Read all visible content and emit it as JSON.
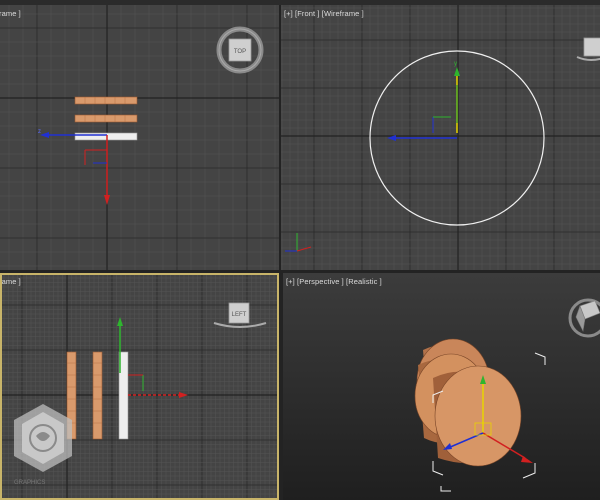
{
  "viewports": {
    "top": {
      "label": "rame ]",
      "viewcube": "TOP"
    },
    "front": {
      "label": "[+] [Front ] [Wireframe ]"
    },
    "left": {
      "label": "rame ]",
      "viewcube": "LEFT"
    },
    "perspective": {
      "label": "[+] [Perspective ] [Realistic ]"
    }
  },
  "watermark": {
    "text": "GRAPHICS"
  },
  "colors": {
    "viewport_bg": "#444444",
    "grid_minor": "#555555",
    "grid_major": "#2a2a2a",
    "active_border": "#c8b469",
    "object_orange": "#d99a6c",
    "object_white": "#eeeeee",
    "axis_x": "#d22020",
    "axis_y": "#2eb52e",
    "axis_z": "#2030d2",
    "gizmo_yellow": "#e8d400"
  }
}
